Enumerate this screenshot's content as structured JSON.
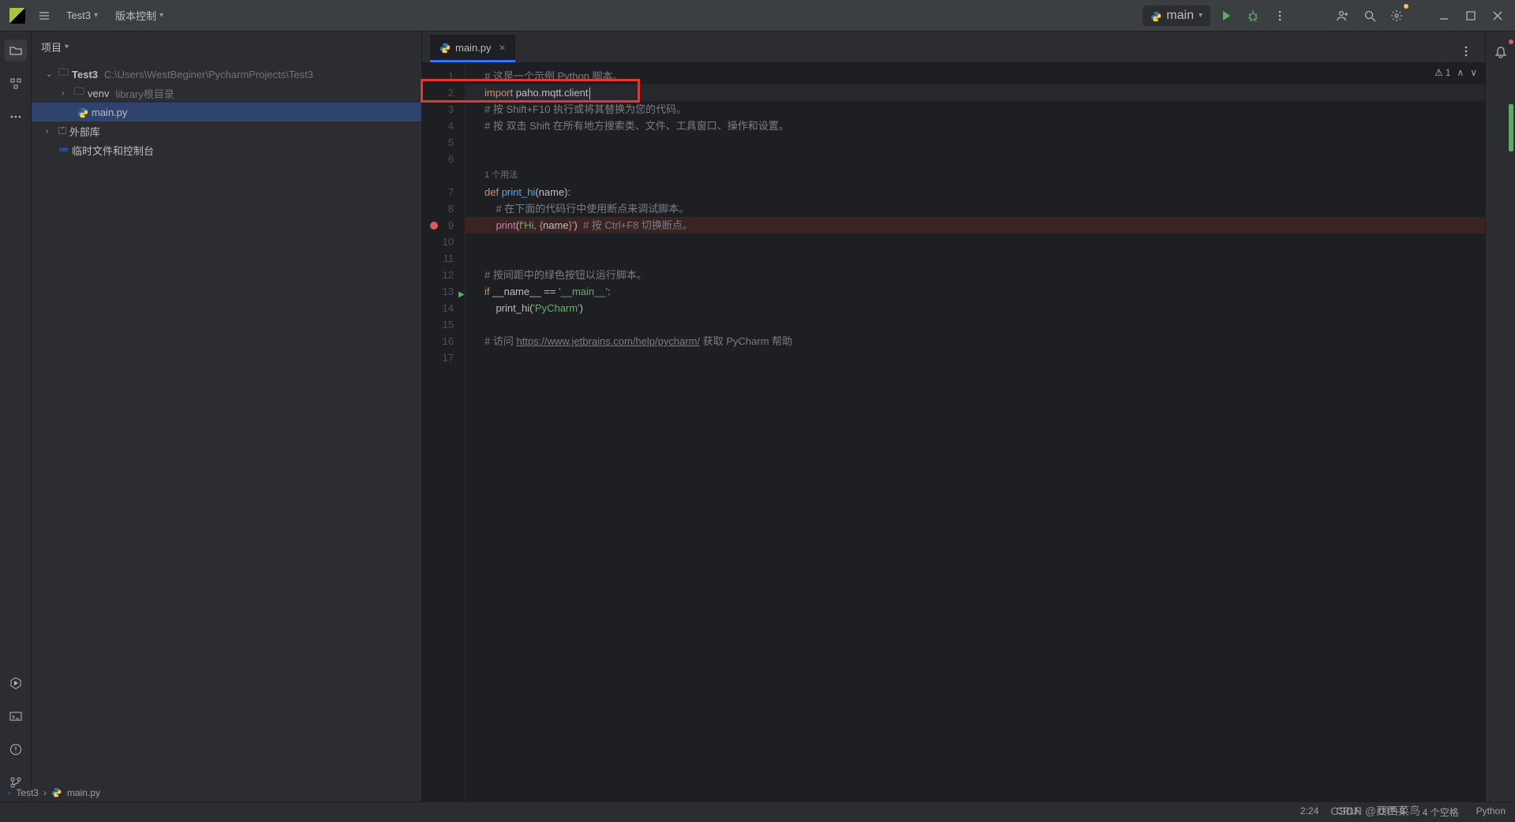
{
  "toolbar": {
    "project_name": "Test3",
    "vcs_label": "版本控制",
    "run_config": "main"
  },
  "project_panel": {
    "title": "项目",
    "root": {
      "name": "Test3",
      "path": "C:\\Users\\WestBeginer\\PycharmProjects\\Test3"
    },
    "venv": {
      "name": "venv",
      "hint": "library根目录"
    },
    "file": "main.py",
    "ext_libs": "外部库",
    "scratches": "临时文件和控制台"
  },
  "tabs": {
    "main": "main.py"
  },
  "gutter": {
    "usage_hint": "1 个用法"
  },
  "code": {
    "l1": "# 这是一个示例 Python 脚本。",
    "l2_kw": "import ",
    "l2_mod": "paho.mqtt.client",
    "l3": "# 按 Shift+F10 执行或将其替换为您的代码。",
    "l4": "# 按 双击 Shift 在所有地方搜索类、文件、工具窗口、操作和设置。",
    "l7_def": "def ",
    "l7_fn": "print_hi",
    "l7_rest": "(name):",
    "l8": "    # 在下面的代码行中使用断点来调试脚本。",
    "l9_a": "    ",
    "l9_print": "print",
    "l9_b": "(",
    "l9_f": "f'Hi, ",
    "l9_br1": "{",
    "l9_name": "name",
    "l9_br2": "}",
    "l9_end": "'",
    "l9_c": ")",
    "l9_cmt": "  # 按 Ctrl+F8 切换断点。",
    "l12": "# 按间距中的绿色按钮以运行脚本。",
    "l13_if": "if ",
    "l13_name": "__name__",
    "l13_eq": " == ",
    "l13_main": "'__main__'",
    "l13_colon": ":",
    "l14_a": "    print_hi(",
    "l14_str": "'PyCharm'",
    "l14_b": ")",
    "l16_a": "# 访问 ",
    "l16_url": "https://www.jetbrains.com/help/pycharm/",
    "l16_b": " 获取 PyCharm 帮助"
  },
  "editor_status": {
    "warnings": "1"
  },
  "breadcrumb": {
    "root": "Test3",
    "file": "main.py"
  },
  "status": {
    "pos": "2:24",
    "eol": "CRLF",
    "enc": "UTF-8",
    "indent": "4 个空格",
    "lang": "Python"
  },
  "watermark": "CSDN @西西菜鸟"
}
